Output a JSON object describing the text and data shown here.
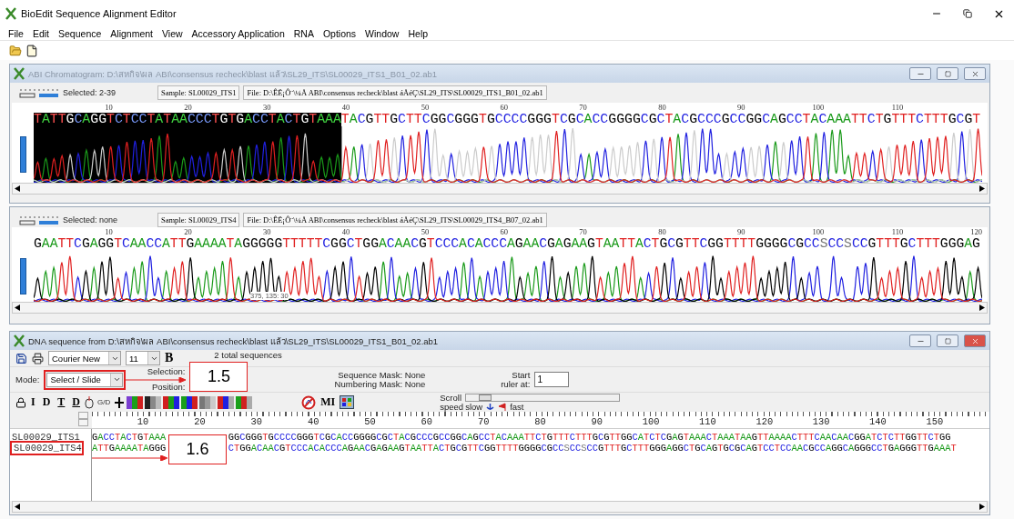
{
  "app": {
    "title": "BioEdit Sequence Alignment Editor",
    "menu": [
      "File",
      "Edit",
      "Sequence",
      "Alignment",
      "View",
      "Accessory Application",
      "RNA",
      "Options",
      "Window",
      "Help"
    ]
  },
  "chromatograms": [
    {
      "title": "ABI Chromatogram: D:\\สหกิจ\\ผล ABI\\consensus recheck\\blast แล้ว\\SL29_ITS\\SL00029_ITS1_B01_02.ab1",
      "selected_label": "Selected: 2-39",
      "sample": "Sample: SL00029_ITS1",
      "file": "File: D:\\ÊË¡Ô¨\\¼Å ABI\\consensus recheck\\blast áÅéÇ\\SL29_ITS\\SL00029_ITS1_B01_02.ab1",
      "positions": [
        "10",
        "20",
        "30",
        "40",
        "50",
        "60",
        "70",
        "80",
        "90",
        "100",
        "110"
      ],
      "selected_bases": "TATTGCAGGTCTCCTATAACCCTGTGACCTACTGTAAA",
      "bases": "TACGTTGCTTCGGCGGGTGCCCCGGGTCGCACCGGGGCGCTACGCCCGCCGGCAGCCTACAAATTCTGTTTCTTTGCGT"
    },
    {
      "selected_label": "Selected: none",
      "sample": "Sample: SL00029_ITS4",
      "file": "File: D:\\ÊË¡Ô¨\\¼Å ABI\\consensus recheck\\blast áÅéÇ\\SL29_ITS\\SL00029_ITS4_B07_02.ab1",
      "positions": [
        "10",
        "20",
        "30",
        "40",
        "50",
        "60",
        "70",
        "80",
        "90",
        "100",
        "110",
        "120"
      ],
      "bases": "GAATTCGAGGTCAACCATTGAAAATAGGGGGTTTTTCGGCTGGACAACGTCCCACACCCAGAACGAGAAGTAATTACTGCGTTCGGTTTTGGGGCGCCSCCSCCGTTTGCTTTGGGAG",
      "readout": "375, 135: 30"
    }
  ],
  "dna_window": {
    "title": "DNA sequence from D:\\สหกิจ\\ผล ABI\\consensus recheck\\blast แล้ว\\SL29_ITS\\SL00029_ITS1_B01_02.ab1",
    "font": "Courier New",
    "size": "11",
    "bold_button": "B",
    "total": "2 total sequences",
    "mode_label": "Mode:",
    "mode": "Select / Slide",
    "selection_label": "Selection:",
    "position_label": "Position:",
    "sequence_mask": "Sequence Mask: None",
    "numbering_mask": "Numbering Mask: None",
    "start_label": "Start",
    "ruler_at_label": "ruler at:",
    "start_value": "1",
    "tool_letters": [
      "I",
      "D",
      "T",
      "D",
      "G/D"
    ],
    "mi": "MI",
    "scroll_label": "Scroll",
    "speed_label": "speed",
    "slow": "slow",
    "fast": "fast",
    "scroll_speed": {
      "level": 0.08
    },
    "ruler": [
      "10",
      "20",
      "30",
      "40",
      "50",
      "60",
      "70",
      "80",
      "90",
      "100",
      "110",
      "120",
      "130",
      "140",
      "150"
    ],
    "sequences": [
      {
        "name": "SL00029_ITS1",
        "before": "GACCTACTGTAAA",
        "after": "GGCGGGTGCCCCGGGTCGCACCGGGGCGCTACGCCCGCCGGCAGCCTACAAATTCTGTTTCTTTGCGTTGGCATCTCGAGTAAACTAAATAAGTTAAAACTTTCAACAACGGATCTCTTGGTTCTGG"
      },
      {
        "name": "SL00029_ITS4",
        "before": "ATTGAAAATAGGG",
        "after": "CTGGACAACGTCCCACACCCAGAACGAGAAGTAATTACTGCGTTCGGTTTTGGGGCGCCSCCSCCGTTTGCTTTGGGAGGCTGCAGTGCGCAGTCCTCCAACGCCAGGCAGGGCCTGAGGGTTGAAAT"
      }
    ]
  },
  "annotations": [
    {
      "label": "1.5"
    },
    {
      "label": "1.6"
    }
  ]
}
